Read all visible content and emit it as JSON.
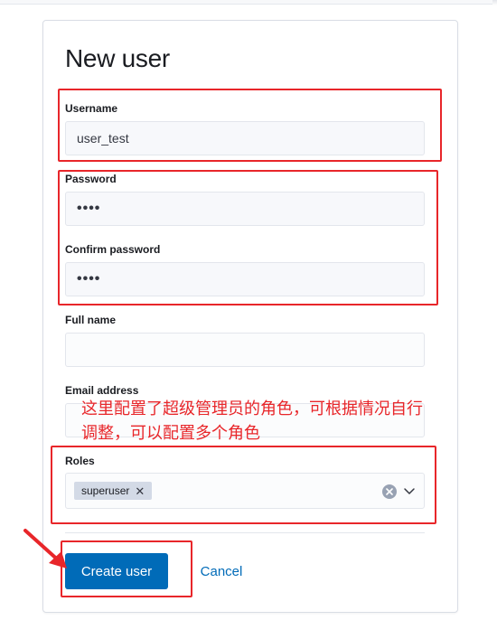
{
  "form": {
    "title": "New user",
    "username": {
      "label": "Username",
      "value": "user_test"
    },
    "password": {
      "label": "Password",
      "value": "••••"
    },
    "confirm_password": {
      "label": "Confirm password",
      "value": "••••"
    },
    "full_name": {
      "label": "Full name",
      "value": ""
    },
    "email": {
      "label": "Email address",
      "value": ""
    },
    "roles": {
      "label": "Roles",
      "selected": [
        "superuser"
      ]
    },
    "create_label": "Create user",
    "cancel_label": "Cancel"
  },
  "annotation": {
    "text": "这里配置了超级管理员的角色，可根据情况自行调整，可以配置多个角色",
    "color": "#e8262a"
  },
  "colors": {
    "primary": "#006bb8",
    "highlight": "#e8262a"
  },
  "icons": [
    "clear-icon",
    "chevron-down-icon",
    "close-icon",
    "arrow-icon"
  ]
}
